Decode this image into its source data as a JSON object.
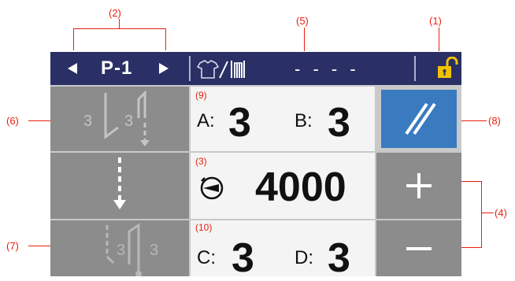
{
  "callouts": {
    "c1": "(1)",
    "c2": "(2)",
    "c3": "(3)",
    "c4": "(4)",
    "c5": "(5)",
    "c6": "(6)",
    "c7": "(7)",
    "c8": "(8)",
    "c9": "(9)",
    "c10": "(10)"
  },
  "header": {
    "program": "P-1",
    "status": "- - - -",
    "icons": [
      "prev-arrow-icon",
      "next-arrow-icon",
      "shirt-icon",
      "thread-counter-icon",
      "unlock-icon"
    ]
  },
  "counters": {
    "top": {
      "a_label": "A:",
      "a_value": "3",
      "b_label": "B:",
      "b_value": "3"
    },
    "mid": {
      "value": "4000",
      "icon": "speed-dial-icon"
    },
    "bottom": {
      "c_label": "C:",
      "c_value": "3",
      "d_label": "D:",
      "d_value": "3"
    }
  },
  "left_buttons": {
    "top_left_num": "3",
    "top_right_num": "3",
    "bottom_left_num": "3",
    "bottom_right_num": "3"
  },
  "right_buttons": {
    "plus": "+",
    "minus": "−"
  },
  "colors": {
    "header_bg": "#2a3065",
    "accent_blue": "#3a7bbf",
    "callout_red": "#e8200f",
    "lock_yellow": "#f2c200"
  }
}
